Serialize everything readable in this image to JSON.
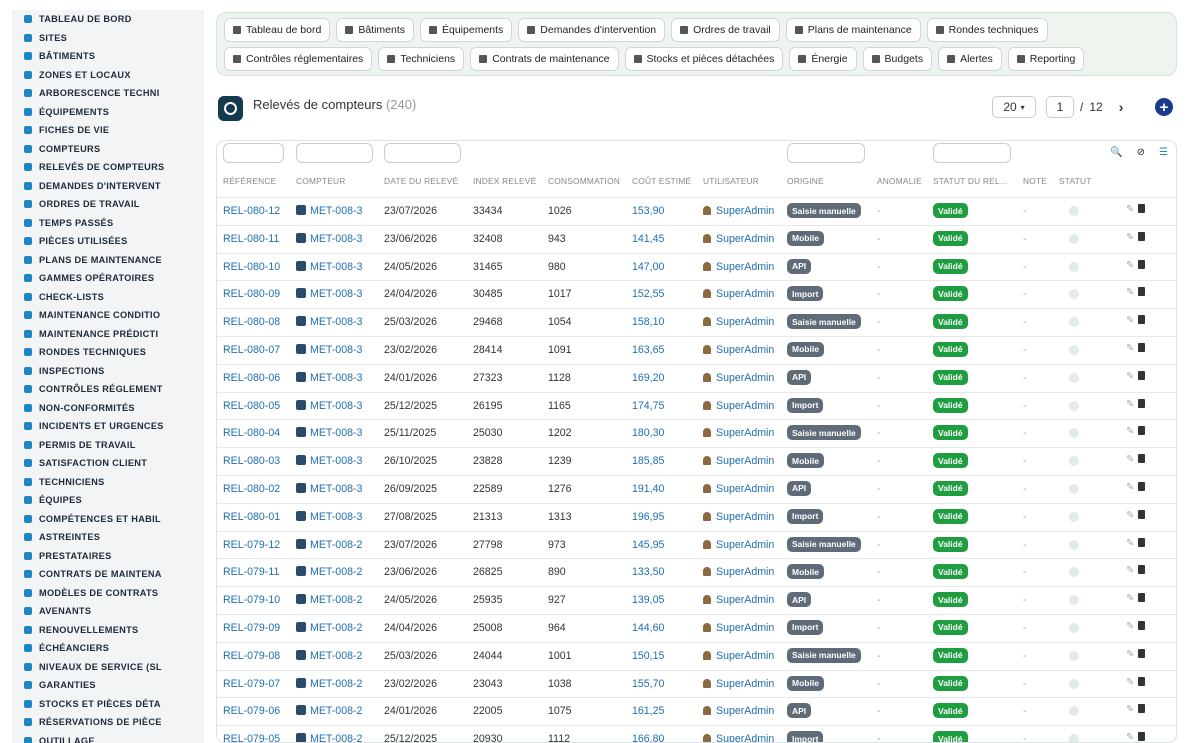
{
  "sidebar": {
    "items": [
      {
        "label": "TABLEAU DE BORD",
        "icon": "dashboard-icon"
      },
      {
        "label": "SITES",
        "icon": "map-pin-icon"
      },
      {
        "label": "BÂTIMENTS",
        "icon": "building-icon"
      },
      {
        "label": "ZONES ET LOCAUX",
        "icon": "zone-icon"
      },
      {
        "label": "ARBORESCENCE TECHNI",
        "icon": "tree-icon"
      },
      {
        "label": "ÉQUIPEMENTS",
        "icon": "gears-icon"
      },
      {
        "label": "FICHES DE VIE",
        "icon": "history-icon"
      },
      {
        "label": "COMPTEURS",
        "icon": "gauge-icon"
      },
      {
        "label": "RELEVÉS DE COMPTEURS",
        "icon": "reading-icon"
      },
      {
        "label": "DEMANDES D'INTERVENT",
        "icon": "question-icon"
      },
      {
        "label": "ORDRES DE TRAVAIL",
        "icon": "clipboard-icon"
      },
      {
        "label": "TEMPS PASSÉS",
        "icon": "clock-icon"
      },
      {
        "label": "PIÈCES UTILISÉES",
        "icon": "boxes-icon"
      },
      {
        "label": "PLANS DE MAINTENANCE",
        "icon": "calendar-icon"
      },
      {
        "label": "GAMMES OPÉRATOIRES",
        "icon": "list-icon"
      },
      {
        "label": "CHECK-LISTS",
        "icon": "checklist-icon"
      },
      {
        "label": "MAINTENANCE CONDITIO",
        "icon": "thermometer-icon"
      },
      {
        "label": "MAINTENANCE PRÉDICTI",
        "icon": "chart-icon"
      },
      {
        "label": "RONDES TECHNIQUES",
        "icon": "route-icon"
      },
      {
        "label": "INSPECTIONS",
        "icon": "search-icon"
      },
      {
        "label": "CONTRÔLES RÉGLEMENT",
        "icon": "clipboard-check-icon"
      },
      {
        "label": "NON-CONFORMITÉS",
        "icon": "warning-circle-icon"
      },
      {
        "label": "INCIDENTS ET URGENCES",
        "icon": "alert-triangle-icon"
      },
      {
        "label": "PERMIS DE TRAVAIL",
        "icon": "document-icon"
      },
      {
        "label": "SATISFACTION CLIENT",
        "icon": "smile-icon"
      },
      {
        "label": "TECHNICIENS",
        "icon": "helmet-icon"
      },
      {
        "label": "ÉQUIPES",
        "icon": "users-icon"
      },
      {
        "label": "COMPÉTENCES ET HABIL",
        "icon": "badge-icon"
      },
      {
        "label": "ASTREINTES",
        "icon": "phone-icon"
      },
      {
        "label": "PRESTATAIRES",
        "icon": "handshake-icon"
      },
      {
        "label": "CONTRATS DE MAINTENA",
        "icon": "contract-icon"
      },
      {
        "label": "MODÈLES DE CONTRATS",
        "icon": "file-icon"
      },
      {
        "label": "AVENANTS",
        "icon": "edit-file-icon"
      },
      {
        "label": "RENOUVELLEMENTS",
        "icon": "refresh-icon"
      },
      {
        "label": "ÉCHÉANCIERS",
        "icon": "calendar-list-icon"
      },
      {
        "label": "NIVEAUX DE SERVICE (SL",
        "icon": "speed-icon"
      },
      {
        "label": "GARANTIES",
        "icon": "shield-icon"
      },
      {
        "label": "STOCKS ET PIÈCES DÉTA",
        "icon": "boxes-icon"
      },
      {
        "label": "RÉSERVATIONS DE PIÈCE",
        "icon": "bookmark-icon"
      },
      {
        "label": "OUTILLAGE",
        "icon": "wrench-icon"
      }
    ]
  },
  "menu": {
    "row1": [
      {
        "label": "Tableau de bord",
        "icon": "dashboard-icon"
      },
      {
        "label": "Bâtiments",
        "icon": "building-icon"
      },
      {
        "label": "Équipements",
        "icon": "gears-icon"
      },
      {
        "label": "Demandes d'intervention",
        "icon": "question-icon"
      },
      {
        "label": "Ordres de travail",
        "icon": "clipboard-icon"
      },
      {
        "label": "Plans de maintenance",
        "icon": "calendar-icon"
      },
      {
        "label": "Rondes techniques",
        "icon": "route-icon"
      }
    ],
    "row2": [
      {
        "label": "Contrôles réglementaires",
        "icon": "clipboard-check-icon"
      },
      {
        "label": "Techniciens",
        "icon": "helmet-icon"
      },
      {
        "label": "Contrats de maintenance",
        "icon": "contract-icon"
      },
      {
        "label": "Stocks et pièces détachées",
        "icon": "boxes-icon"
      },
      {
        "label": "Énergie",
        "icon": "bolt-icon"
      },
      {
        "label": "Budgets",
        "icon": "money-icon"
      },
      {
        "label": "Alertes",
        "icon": "bell-icon"
      },
      {
        "label": "Reporting",
        "icon": "pie-icon"
      }
    ]
  },
  "page": {
    "title": "Relevés de compteurs",
    "count": "(240)"
  },
  "pager": {
    "page_size": "20",
    "current": "1",
    "separator": "/",
    "total": "12",
    "next": "›",
    "add": "+"
  },
  "table": {
    "columns": [
      "RÉFÉRENCE",
      "COMPTEUR",
      "DATE DU RELEVÉ",
      "INDEX RELEVÉ",
      "CONSOMMATION",
      "COÛT ESTIMÉ",
      "UTILISATEUR",
      "ORIGINE",
      "ANOMALIE",
      "STATUT DU REL...",
      "NOTE",
      "STATUT"
    ],
    "rows": [
      {
        "ref": "REL-080-12",
        "meter": "MET-008-3",
        "date": "23/07/2026",
        "index": "33434",
        "conso": "1026",
        "cost": "153,90",
        "user": "SuperAdmin",
        "origin": "Saisie manuelle",
        "anomaly": "-",
        "status": "Validé",
        "note": "-"
      },
      {
        "ref": "REL-080-11",
        "meter": "MET-008-3",
        "date": "23/06/2026",
        "index": "32408",
        "conso": "943",
        "cost": "141,45",
        "user": "SuperAdmin",
        "origin": "Mobile",
        "anomaly": "-",
        "status": "Validé",
        "note": "-"
      },
      {
        "ref": "REL-080-10",
        "meter": "MET-008-3",
        "date": "24/05/2026",
        "index": "31465",
        "conso": "980",
        "cost": "147,00",
        "user": "SuperAdmin",
        "origin": "API",
        "anomaly": "-",
        "status": "Validé",
        "note": "-"
      },
      {
        "ref": "REL-080-09",
        "meter": "MET-008-3",
        "date": "24/04/2026",
        "index": "30485",
        "conso": "1017",
        "cost": "152,55",
        "user": "SuperAdmin",
        "origin": "Import",
        "anomaly": "-",
        "status": "Validé",
        "note": "-"
      },
      {
        "ref": "REL-080-08",
        "meter": "MET-008-3",
        "date": "25/03/2026",
        "index": "29468",
        "conso": "1054",
        "cost": "158,10",
        "user": "SuperAdmin",
        "origin": "Saisie manuelle",
        "anomaly": "-",
        "status": "Validé",
        "note": "-"
      },
      {
        "ref": "REL-080-07",
        "meter": "MET-008-3",
        "date": "23/02/2026",
        "index": "28414",
        "conso": "1091",
        "cost": "163,65",
        "user": "SuperAdmin",
        "origin": "Mobile",
        "anomaly": "-",
        "status": "Validé",
        "note": "-"
      },
      {
        "ref": "REL-080-06",
        "meter": "MET-008-3",
        "date": "24/01/2026",
        "index": "27323",
        "conso": "1128",
        "cost": "169,20",
        "user": "SuperAdmin",
        "origin": "API",
        "anomaly": "-",
        "status": "Validé",
        "note": "-"
      },
      {
        "ref": "REL-080-05",
        "meter": "MET-008-3",
        "date": "25/12/2025",
        "index": "26195",
        "conso": "1165",
        "cost": "174,75",
        "user": "SuperAdmin",
        "origin": "Import",
        "anomaly": "-",
        "status": "Validé",
        "note": "-"
      },
      {
        "ref": "REL-080-04",
        "meter": "MET-008-3",
        "date": "25/11/2025",
        "index": "25030",
        "conso": "1202",
        "cost": "180,30",
        "user": "SuperAdmin",
        "origin": "Saisie manuelle",
        "anomaly": "-",
        "status": "Validé",
        "note": "-"
      },
      {
        "ref": "REL-080-03",
        "meter": "MET-008-3",
        "date": "26/10/2025",
        "index": "23828",
        "conso": "1239",
        "cost": "185,85",
        "user": "SuperAdmin",
        "origin": "Mobile",
        "anomaly": "-",
        "status": "Validé",
        "note": "-"
      },
      {
        "ref": "REL-080-02",
        "meter": "MET-008-3",
        "date": "26/09/2025",
        "index": "22589",
        "conso": "1276",
        "cost": "191,40",
        "user": "SuperAdmin",
        "origin": "API",
        "anomaly": "-",
        "status": "Validé",
        "note": "-"
      },
      {
        "ref": "REL-080-01",
        "meter": "MET-008-3",
        "date": "27/08/2025",
        "index": "21313",
        "conso": "1313",
        "cost": "196,95",
        "user": "SuperAdmin",
        "origin": "Import",
        "anomaly": "-",
        "status": "Validé",
        "note": "-"
      },
      {
        "ref": "REL-079-12",
        "meter": "MET-008-2",
        "date": "23/07/2026",
        "index": "27798",
        "conso": "973",
        "cost": "145,95",
        "user": "SuperAdmin",
        "origin": "Saisie manuelle",
        "anomaly": "-",
        "status": "Validé",
        "note": "-"
      },
      {
        "ref": "REL-079-11",
        "meter": "MET-008-2",
        "date": "23/06/2026",
        "index": "26825",
        "conso": "890",
        "cost": "133,50",
        "user": "SuperAdmin",
        "origin": "Mobile",
        "anomaly": "-",
        "status": "Validé",
        "note": "-"
      },
      {
        "ref": "REL-079-10",
        "meter": "MET-008-2",
        "date": "24/05/2026",
        "index": "25935",
        "conso": "927",
        "cost": "139,05",
        "user": "SuperAdmin",
        "origin": "API",
        "anomaly": "-",
        "status": "Validé",
        "note": "-"
      },
      {
        "ref": "REL-079-09",
        "meter": "MET-008-2",
        "date": "24/04/2026",
        "index": "25008",
        "conso": "964",
        "cost": "144,60",
        "user": "SuperAdmin",
        "origin": "Import",
        "anomaly": "-",
        "status": "Validé",
        "note": "-"
      },
      {
        "ref": "REL-079-08",
        "meter": "MET-008-2",
        "date": "25/03/2026",
        "index": "24044",
        "conso": "1001",
        "cost": "150,15",
        "user": "SuperAdmin",
        "origin": "Saisie manuelle",
        "anomaly": "-",
        "status": "Validé",
        "note": "-"
      },
      {
        "ref": "REL-079-07",
        "meter": "MET-008-2",
        "date": "23/02/2026",
        "index": "23043",
        "conso": "1038",
        "cost": "155,70",
        "user": "SuperAdmin",
        "origin": "Mobile",
        "anomaly": "-",
        "status": "Validé",
        "note": "-"
      },
      {
        "ref": "REL-079-06",
        "meter": "MET-008-2",
        "date": "24/01/2026",
        "index": "22005",
        "conso": "1075",
        "cost": "161,25",
        "user": "SuperAdmin",
        "origin": "API",
        "anomaly": "-",
        "status": "Validé",
        "note": "-"
      },
      {
        "ref": "REL-079-05",
        "meter": "MET-008-2",
        "date": "25/12/2025",
        "index": "20930",
        "conso": "1112",
        "cost": "166,80",
        "user": "SuperAdmin",
        "origin": "Import",
        "anomaly": "-",
        "status": "Validé",
        "note": "-"
      }
    ]
  },
  "colors": {
    "accent": "#1f86c6",
    "link": "#1f6fb0",
    "status_green": "#1e9e40",
    "origin_gray": "#5f6b78",
    "menu_bg": "#eef5ee"
  }
}
